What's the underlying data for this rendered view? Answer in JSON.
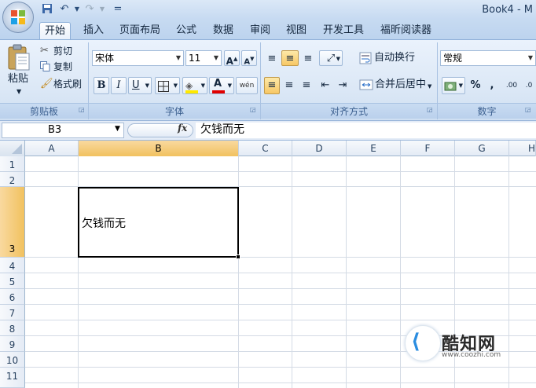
{
  "window": {
    "title": "Book4 - M"
  },
  "quick_access": {
    "save": "save-icon",
    "undo": "undo-icon",
    "redo": "redo-icon",
    "customize": "="
  },
  "tabs": [
    "开始",
    "插入",
    "页面布局",
    "公式",
    "数据",
    "审阅",
    "视图",
    "开发工具",
    "福昕阅读器"
  ],
  "clipboard": {
    "paste": "粘贴",
    "cut": "剪切",
    "copy": "复制",
    "format_painter": "格式刷",
    "group": "剪贴板"
  },
  "font": {
    "name": "宋体",
    "size": "11",
    "bold": "B",
    "italic": "I",
    "underline": "U",
    "font_color": "A",
    "phonetic": "wén",
    "group": "字体"
  },
  "alignment": {
    "wrap_text": "自动换行",
    "merge_center": "合并后居中",
    "group": "对齐方式"
  },
  "number": {
    "format": "常规",
    "percent": "%",
    "comma": ",",
    "group": "数字"
  },
  "formula_bar": {
    "name_box": "B3",
    "fx": "fx",
    "content": "欠钱而无"
  },
  "columns": [
    "A",
    "B",
    "C",
    "D",
    "E",
    "F",
    "G",
    "H"
  ],
  "selected_column": "B",
  "rows": [
    "1",
    "2",
    "3",
    "4",
    "5",
    "6",
    "7",
    "8",
    "9",
    "10",
    "11"
  ],
  "selected_row": "3",
  "cells": {
    "B3": "欠钱而无"
  },
  "watermark": {
    "name": "酷知网",
    "url": "www.coozhi.com"
  },
  "colors": {
    "selection_header": "#f1c15f",
    "ribbon": "#dce8f6",
    "accent": "#2b8de0"
  }
}
